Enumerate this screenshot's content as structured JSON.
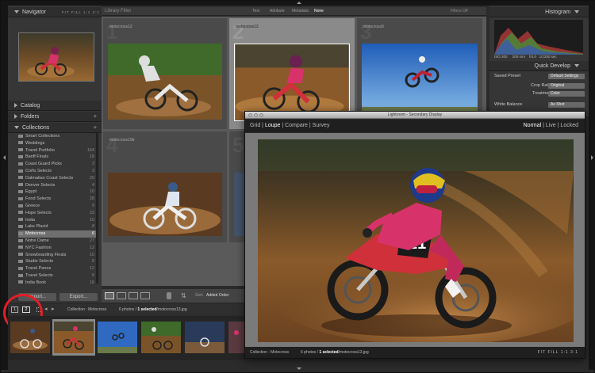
{
  "navigator": {
    "title": "Navigator",
    "zoom_options": [
      "FIT",
      "FILL",
      "1:1",
      "3:1"
    ]
  },
  "library_filter": {
    "title": "Library Filter",
    "options": [
      "Text",
      "Attribute",
      "Metadata",
      "None"
    ],
    "active": "None",
    "filters_off": "Filters Off"
  },
  "left_panel": {
    "catalog": "Catalog",
    "folders": "Folders",
    "collections": "Collections",
    "collection_items": [
      {
        "label": "Smart Collections",
        "count": ""
      },
      {
        "label": "Weddings",
        "count": ""
      },
      {
        "label": "Travel Portfolio",
        "count": "164"
      },
      {
        "label": "Banff Finals",
        "count": "18"
      },
      {
        "label": "Coast Guard Picks",
        "count": "3"
      },
      {
        "label": "Corfu Selects",
        "count": "3"
      },
      {
        "label": "Dalmatian Coast Selects",
        "count": "20"
      },
      {
        "label": "Denver Selects",
        "count": "4"
      },
      {
        "label": "Egypt",
        "count": "10"
      },
      {
        "label": "Food Selects",
        "count": "28"
      },
      {
        "label": "Greece",
        "count": "9"
      },
      {
        "label": "Hope Selects",
        "count": "33"
      },
      {
        "label": "India",
        "count": "10"
      },
      {
        "label": "Lake Placid",
        "count": "8"
      },
      {
        "label": "Motocross",
        "count": "6"
      },
      {
        "label": "Notre Dame",
        "count": "27"
      },
      {
        "label": "NYC Fashion",
        "count": "13"
      },
      {
        "label": "Snowboarding Finals",
        "count": "10"
      },
      {
        "label": "Studio Selects",
        "count": "8"
      },
      {
        "label": "Travel Panos",
        "count": "12"
      },
      {
        "label": "Travel Selects",
        "count": "6"
      },
      {
        "label": "India Book",
        "count": "16"
      }
    ],
    "selected_index": 14,
    "import_label": "Import...",
    "export_label": "Export..."
  },
  "grid": {
    "cells": [
      {
        "num": "1",
        "name": "motocross12"
      },
      {
        "num": "2",
        "name": "motocross13"
      },
      {
        "num": "3",
        "name": "motocross9"
      },
      {
        "num": "4",
        "name": "motocross10b"
      },
      {
        "num": "5",
        "name": ""
      }
    ],
    "sort_label": "Sort:",
    "sort_value": "Added Order"
  },
  "right_panel": {
    "histogram": "Histogram",
    "exposure_info": [
      "ISO 200",
      "200 mm",
      "f/4.0",
      "1/1250 sec"
    ],
    "quick_develop": "Quick Develop",
    "rows": [
      {
        "label": "Saved Preset",
        "value": "Default Settings"
      },
      {
        "label": "Crop Ratio",
        "value": "Original"
      },
      {
        "label": "Treatment",
        "value": "Color"
      },
      {
        "label": "White Balance",
        "value": "As Shot"
      }
    ]
  },
  "filmstrip": {
    "screen1": "1",
    "screen2": "2",
    "collection": "Collection : Motocross",
    "count_prefix": "6 photos /",
    "selected": "1 selected",
    "filename": "/motocross13.jpg"
  },
  "secondary": {
    "title": "Lightroom - Secondary Display",
    "views": [
      "Grid",
      "Loupe",
      "Compare",
      "Survey"
    ],
    "active_view": "Loupe",
    "modes": [
      "Normal",
      "Live",
      "Locked"
    ],
    "active_mode": "Normal",
    "status_collection": "Collection : Motocross",
    "status_count": "6 photos /",
    "status_selected": "1 selected",
    "status_file": "/motocross13.jpg",
    "zoom": [
      "FIT",
      "FILL",
      "1:1",
      "3:1"
    ]
  },
  "colors": {
    "highlight": "#e21e26",
    "rider_pink": "#d8326a",
    "dirt": "#8a5a2a"
  }
}
